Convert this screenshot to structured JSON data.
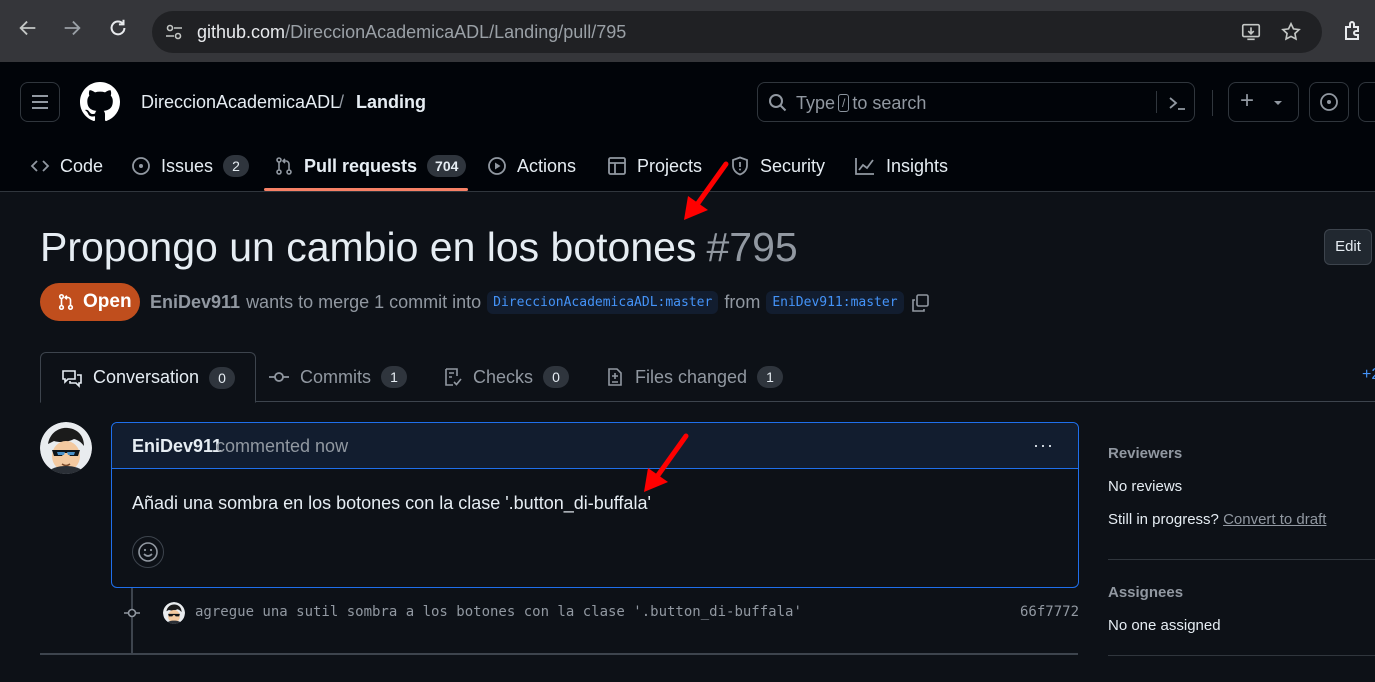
{
  "browser": {
    "url_domain": "github.com",
    "url_path": "/DireccionAcademicaADL/Landing/pull/795"
  },
  "header": {
    "owner": "DireccionAcademicaADL",
    "separator": "/",
    "repo": "Landing",
    "search_pre": "Type",
    "search_key": "/",
    "search_post": "to search",
    "plus_label": "+"
  },
  "repo_tabs": [
    {
      "label": "Code",
      "icon": "code-icon"
    },
    {
      "label": "Issues",
      "icon": "issue-icon",
      "count": "2"
    },
    {
      "label": "Pull requests",
      "icon": "pull-request-icon",
      "count": "704",
      "selected": true
    },
    {
      "label": "Actions",
      "icon": "play-icon"
    },
    {
      "label": "Projects",
      "icon": "table-icon"
    },
    {
      "label": "Security",
      "icon": "shield-icon"
    },
    {
      "label": "Insights",
      "icon": "graph-icon"
    }
  ],
  "pr": {
    "title": "Propongo un cambio en los botones",
    "number": "#795",
    "edit_label": "Edit",
    "state": "Open",
    "author": "EniDev911",
    "merge_text": "wants to merge 1 commit into",
    "base_branch": "DireccionAcademicaADL:master",
    "from_text": "from",
    "head_branch": "EniDev911:master",
    "state_color": "#c04e1d"
  },
  "pr_tabs": [
    {
      "label": "Conversation",
      "count": "0",
      "icon": "comment-discussion-icon"
    },
    {
      "label": "Commits",
      "count": "1",
      "icon": "commit-icon"
    },
    {
      "label": "Checks",
      "count": "0",
      "icon": "checklist-icon"
    },
    {
      "label": "Files changed",
      "count": "1",
      "icon": "file-diff-icon"
    }
  ],
  "pr_tabs_more": "+2",
  "comment": {
    "author": "EniDev911",
    "time": "commented now",
    "body": "Añadi una sombra en los botones con la clase '.button_di-buffala'",
    "menu": "···"
  },
  "commit": {
    "message": "agregue una sutil sombra a los botones con la clase '.button_di-buffala'",
    "sha": "66f7772"
  },
  "sidebar": {
    "reviewers_heading": "Reviewers",
    "reviewers_value": "No reviews",
    "progress_text": "Still in progress?",
    "draft_link": "Convert to draft",
    "assignees_heading": "Assignees",
    "assignees_value": "No one assigned"
  },
  "colors": {
    "accent": "#f78166",
    "link": "#4493f8",
    "annotation_arrow": "#ff0000"
  }
}
